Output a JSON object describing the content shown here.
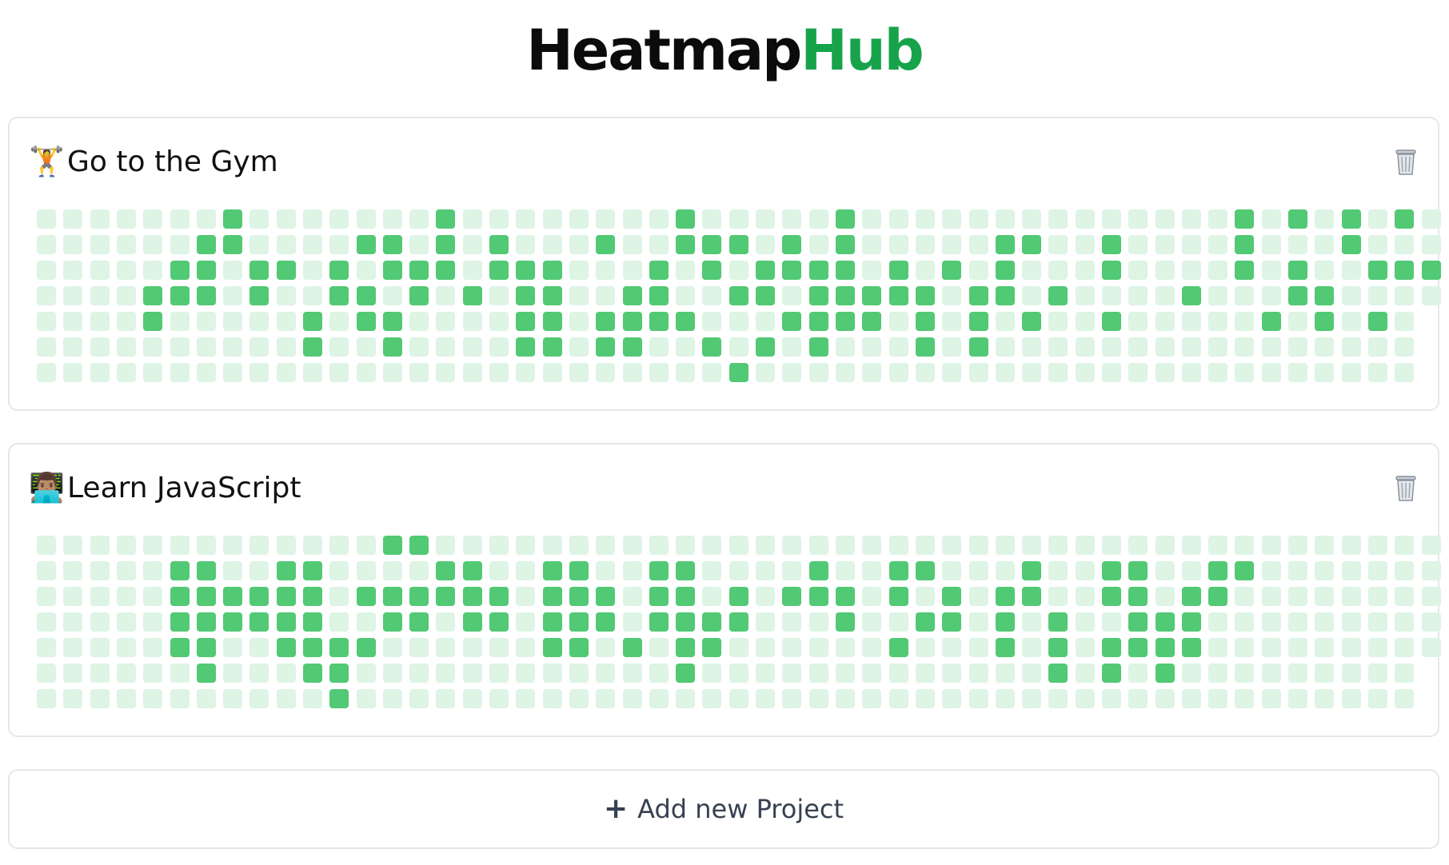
{
  "app": {
    "title_part1": "Heatmap",
    "title_part2": "Hub"
  },
  "colors": {
    "accent": "#16a34a",
    "active_cell": "#52c974",
    "inactive_cell": "#def4e5",
    "border": "#e5e7eb"
  },
  "projects": [
    {
      "name": "Go to the Gym",
      "emoji": "🏋️",
      "delete_icon": "trash-icon",
      "weeks": 52,
      "days_per_week": 7,
      "last_week_days": 4,
      "active": [
        [
          0,
          7
        ],
        [
          0,
          15
        ],
        [
          0,
          24
        ],
        [
          0,
          30
        ],
        [
          0,
          45
        ],
        [
          0,
          47
        ],
        [
          0,
          49
        ],
        [
          0,
          51
        ],
        [
          1,
          6
        ],
        [
          1,
          7
        ],
        [
          1,
          12
        ],
        [
          1,
          13
        ],
        [
          1,
          15
        ],
        [
          1,
          17
        ],
        [
          1,
          21
        ],
        [
          1,
          24
        ],
        [
          1,
          25
        ],
        [
          1,
          26
        ],
        [
          1,
          28
        ],
        [
          1,
          30
        ],
        [
          1,
          36
        ],
        [
          1,
          37
        ],
        [
          1,
          40
        ],
        [
          1,
          45
        ],
        [
          1,
          49
        ],
        [
          2,
          5
        ],
        [
          2,
          6
        ],
        [
          2,
          8
        ],
        [
          2,
          9
        ],
        [
          2,
          11
        ],
        [
          2,
          13
        ],
        [
          2,
          14
        ],
        [
          2,
          15
        ],
        [
          2,
          17
        ],
        [
          2,
          18
        ],
        [
          2,
          19
        ],
        [
          2,
          23
        ],
        [
          2,
          25
        ],
        [
          2,
          27
        ],
        [
          2,
          28
        ],
        [
          2,
          29
        ],
        [
          2,
          30
        ],
        [
          2,
          32
        ],
        [
          2,
          34
        ],
        [
          2,
          36
        ],
        [
          2,
          40
        ],
        [
          2,
          45
        ],
        [
          2,
          47
        ],
        [
          2,
          50
        ],
        [
          2,
          51
        ],
        [
          2,
          52
        ],
        [
          3,
          4
        ],
        [
          3,
          5
        ],
        [
          3,
          6
        ],
        [
          3,
          8
        ],
        [
          3,
          11
        ],
        [
          3,
          12
        ],
        [
          3,
          14
        ],
        [
          3,
          16
        ],
        [
          3,
          18
        ],
        [
          3,
          19
        ],
        [
          3,
          22
        ],
        [
          3,
          23
        ],
        [
          3,
          26
        ],
        [
          3,
          27
        ],
        [
          3,
          29
        ],
        [
          3,
          30
        ],
        [
          3,
          31
        ],
        [
          3,
          32
        ],
        [
          3,
          33
        ],
        [
          3,
          35
        ],
        [
          3,
          36
        ],
        [
          3,
          38
        ],
        [
          3,
          43
        ],
        [
          3,
          47
        ],
        [
          3,
          48
        ],
        [
          4,
          4
        ],
        [
          4,
          10
        ],
        [
          4,
          12
        ],
        [
          4,
          13
        ],
        [
          4,
          18
        ],
        [
          4,
          19
        ],
        [
          4,
          21
        ],
        [
          4,
          22
        ],
        [
          4,
          23
        ],
        [
          4,
          24
        ],
        [
          4,
          28
        ],
        [
          4,
          29
        ],
        [
          4,
          30
        ],
        [
          4,
          31
        ],
        [
          4,
          33
        ],
        [
          4,
          35
        ],
        [
          4,
          37
        ],
        [
          4,
          40
        ],
        [
          4,
          46
        ],
        [
          4,
          48
        ],
        [
          4,
          50
        ],
        [
          5,
          10
        ],
        [
          5,
          13
        ],
        [
          5,
          18
        ],
        [
          5,
          19
        ],
        [
          5,
          21
        ],
        [
          5,
          22
        ],
        [
          5,
          25
        ],
        [
          5,
          27
        ],
        [
          5,
          29
        ],
        [
          5,
          33
        ],
        [
          5,
          35
        ],
        [
          6,
          26
        ]
      ]
    },
    {
      "name": "Learn JavaScript",
      "emoji": "👨🏽‍💻",
      "delete_icon": "trash-icon",
      "weeks": 52,
      "days_per_week": 7,
      "last_week_days": 5,
      "active": [
        [
          0,
          13
        ],
        [
          0,
          14
        ],
        [
          1,
          5
        ],
        [
          1,
          6
        ],
        [
          1,
          9
        ],
        [
          1,
          10
        ],
        [
          1,
          15
        ],
        [
          1,
          16
        ],
        [
          1,
          19
        ],
        [
          1,
          20
        ],
        [
          1,
          23
        ],
        [
          1,
          24
        ],
        [
          1,
          29
        ],
        [
          1,
          32
        ],
        [
          1,
          33
        ],
        [
          1,
          37
        ],
        [
          1,
          40
        ],
        [
          1,
          41
        ],
        [
          1,
          44
        ],
        [
          1,
          45
        ],
        [
          2,
          5
        ],
        [
          2,
          6
        ],
        [
          2,
          7
        ],
        [
          2,
          8
        ],
        [
          2,
          9
        ],
        [
          2,
          10
        ],
        [
          2,
          12
        ],
        [
          2,
          13
        ],
        [
          2,
          14
        ],
        [
          2,
          15
        ],
        [
          2,
          16
        ],
        [
          2,
          17
        ],
        [
          2,
          19
        ],
        [
          2,
          20
        ],
        [
          2,
          21
        ],
        [
          2,
          23
        ],
        [
          2,
          24
        ],
        [
          2,
          26
        ],
        [
          2,
          28
        ],
        [
          2,
          29
        ],
        [
          2,
          30
        ],
        [
          2,
          32
        ],
        [
          2,
          34
        ],
        [
          2,
          36
        ],
        [
          2,
          37
        ],
        [
          2,
          40
        ],
        [
          2,
          41
        ],
        [
          2,
          43
        ],
        [
          2,
          44
        ],
        [
          3,
          5
        ],
        [
          3,
          6
        ],
        [
          3,
          7
        ],
        [
          3,
          8
        ],
        [
          3,
          9
        ],
        [
          3,
          10
        ],
        [
          3,
          13
        ],
        [
          3,
          14
        ],
        [
          3,
          16
        ],
        [
          3,
          17
        ],
        [
          3,
          19
        ],
        [
          3,
          20
        ],
        [
          3,
          21
        ],
        [
          3,
          23
        ],
        [
          3,
          24
        ],
        [
          3,
          25
        ],
        [
          3,
          26
        ],
        [
          3,
          30
        ],
        [
          3,
          33
        ],
        [
          3,
          34
        ],
        [
          3,
          36
        ],
        [
          3,
          38
        ],
        [
          3,
          41
        ],
        [
          3,
          42
        ],
        [
          3,
          43
        ],
        [
          4,
          5
        ],
        [
          4,
          6
        ],
        [
          4,
          9
        ],
        [
          4,
          10
        ],
        [
          4,
          11
        ],
        [
          4,
          12
        ],
        [
          4,
          19
        ],
        [
          4,
          20
        ],
        [
          4,
          22
        ],
        [
          4,
          24
        ],
        [
          4,
          25
        ],
        [
          4,
          32
        ],
        [
          4,
          36
        ],
        [
          4,
          38
        ],
        [
          4,
          40
        ],
        [
          4,
          41
        ],
        [
          4,
          42
        ],
        [
          4,
          43
        ],
        [
          5,
          6
        ],
        [
          5,
          10
        ],
        [
          5,
          11
        ],
        [
          5,
          24
        ],
        [
          5,
          38
        ],
        [
          5,
          40
        ],
        [
          5,
          42
        ],
        [
          6,
          11
        ]
      ]
    }
  ],
  "add_project": {
    "icon": "plus-icon",
    "label": "Add new Project"
  }
}
